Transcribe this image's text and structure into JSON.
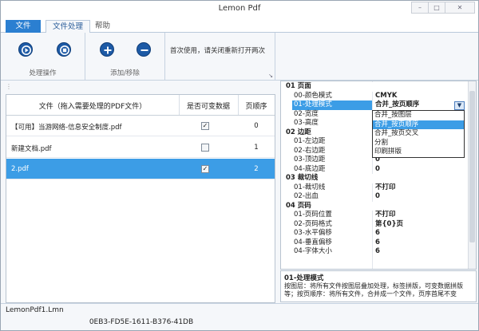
{
  "window": {
    "title": "Lemon Pdf"
  },
  "menu": {
    "file": "文件",
    "process": "文件处理",
    "help": "帮助"
  },
  "ribbon": {
    "groups": [
      {
        "caption": "处理操作",
        "buttons": [
          "play-icon",
          "stop-icon"
        ]
      },
      {
        "caption": "添加/移除",
        "buttons": [
          "add-icon",
          "remove-icon"
        ]
      }
    ],
    "notice": "首次使用，请关闭重新打开两次"
  },
  "file_table": {
    "columns": [
      "文件（拖入需要处理的PDF文件）",
      "是否可变数据",
      "页顺序"
    ],
    "rows": [
      {
        "name": "【可用】当游网络-信息安全制度.pdf",
        "variable": true,
        "order": "0"
      },
      {
        "name": "新建文档.pdf",
        "variable": false,
        "order": "1"
      },
      {
        "name": "2.pdf",
        "variable": true,
        "order": "2"
      }
    ]
  },
  "properties": [
    {
      "type": "cat",
      "key": "01 页面"
    },
    {
      "type": "item",
      "key": "00-颜色模式",
      "value": "CMYK"
    },
    {
      "type": "item",
      "key": "01-处理模式",
      "value": "合并_按页顺序",
      "selected": true
    },
    {
      "type": "item",
      "key": "02-宽度",
      "value": ""
    },
    {
      "type": "item",
      "key": "03-高度",
      "value": ""
    },
    {
      "type": "cat",
      "key": "02 边距"
    },
    {
      "type": "item",
      "key": "01-左边距",
      "value": ""
    },
    {
      "type": "item",
      "key": "02-右边距",
      "value": ""
    },
    {
      "type": "item",
      "key": "03-顶边距",
      "value": "0"
    },
    {
      "type": "item",
      "key": "04-底边距",
      "value": "0"
    },
    {
      "type": "cat",
      "key": "03 裁切线"
    },
    {
      "type": "item",
      "key": "01-裁切线",
      "value": "不打印"
    },
    {
      "type": "item",
      "key": "02-出血",
      "value": "0"
    },
    {
      "type": "cat",
      "key": "04 页码"
    },
    {
      "type": "item",
      "key": "01-页码位置",
      "value": "不打印"
    },
    {
      "type": "item",
      "key": "02-页码格式",
      "value": "第{0}页"
    },
    {
      "type": "item",
      "key": "03-水平偏移",
      "value": "6"
    },
    {
      "type": "item",
      "key": "04-垂直偏移",
      "value": "6"
    },
    {
      "type": "item",
      "key": "04-字体大小",
      "value": "6"
    }
  ],
  "dropdown_options": [
    "合并_按图层",
    "合并_按页顺序",
    "合并_按页交叉",
    "分割",
    "印刷拼版"
  ],
  "dropdown_highlight": 1,
  "description": {
    "title": "01-处理模式",
    "text": "按图层：将所有文件按图层叠加处理，标签拼版，可变数据拼版等；按页顺序：将所有文件，合并成一个文件，页序首尾不变"
  },
  "status": {
    "filename": "LemonPdf1.Lmn",
    "serial": "0EB3-FD5E-1611-B376-41DB"
  }
}
